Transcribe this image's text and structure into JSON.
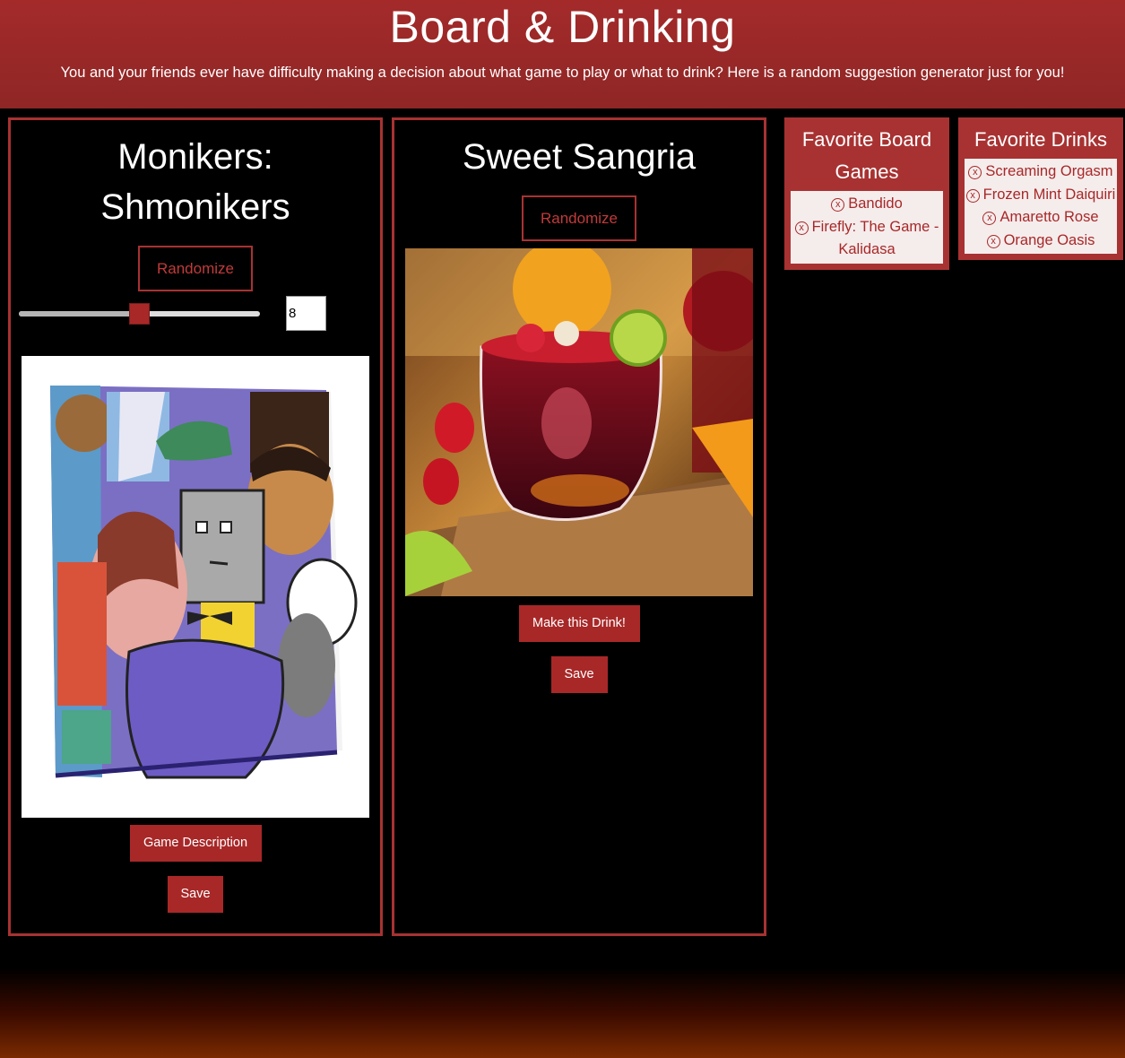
{
  "header": {
    "title": "Board & Drinking",
    "subtitle": "You and your friends ever have difficulty making a decision about what game to play or what to drink? Here is a random suggestion generator just for you!"
  },
  "game_panel": {
    "title_line1": "Monikers:",
    "title_line2": "Shmonikers",
    "randomize_label": "Randomize",
    "slider_value": 8,
    "slider_fraction": 0.5,
    "number_input_value": "8",
    "image_alt": "Monikers: Shmonikers game box",
    "description_button": "Game Description",
    "save_button": "Save"
  },
  "drink_panel": {
    "title": "Sweet Sangria",
    "randomize_label": "Randomize",
    "image_alt": "Sweet Sangria drink",
    "make_button": "Make this Drink!",
    "save_button": "Save"
  },
  "favorite_games": {
    "title_line1": "Favorite Board",
    "title_line2": "Games",
    "remove_icon": "ⓧ",
    "items": [
      "Bandido",
      "Firefly: The Game -",
      "Kalidasa"
    ]
  },
  "favorite_drinks": {
    "title": "Favorite Drinks",
    "remove_icon": "ⓧ",
    "items": [
      "Screaming Orgasm",
      "Frozen Mint Daiquiri",
      "Amaretto Rose",
      "Orange Oasis"
    ]
  },
  "colors": {
    "accent": "#a82828",
    "header_bg": "#9a2828",
    "panel_border": "#a83232"
  }
}
